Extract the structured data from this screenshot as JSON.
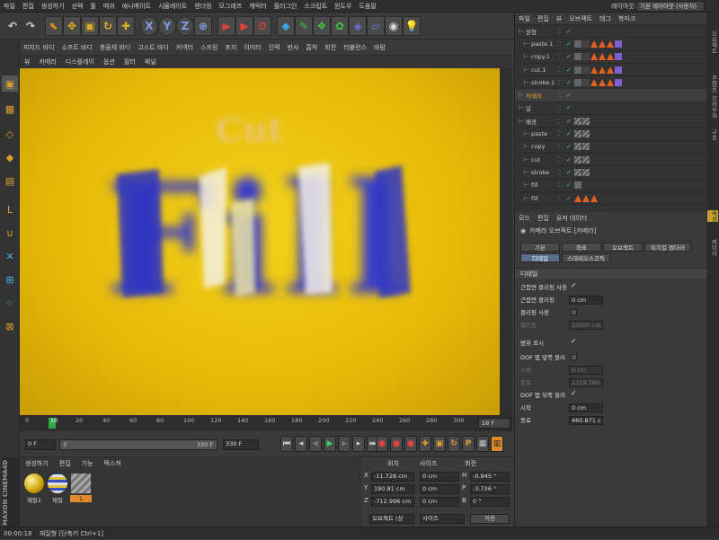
{
  "menu": [
    "파일",
    "편집",
    "생성하기",
    "선택",
    "툴",
    "메쉬",
    "애니메이트",
    "시뮬레이트",
    "렌더링",
    "모그래프",
    "캐릭터",
    "플러그인",
    "스크립트",
    "윈도우",
    "도움말"
  ],
  "layout": {
    "label": "레이아웃:",
    "value": "기본 레이아웃 (사용자)"
  },
  "view_bar": [
    "피지드 바디",
    "소프트 바디",
    "충돌체 바디",
    "고스트 바디",
    "커넥터",
    "스프링",
    "포지",
    "이미터",
    "인력",
    "반사",
    "흡착",
    "회전",
    "터뷸런스",
    "바람"
  ],
  "view_menu": [
    "뷰",
    "카메라",
    "디스플레이",
    "옵션",
    "필터",
    "패널"
  ],
  "viewport": {
    "text_small": "Cut",
    "text_big": "Fill"
  },
  "timeline": {
    "ticks": [
      "0",
      "10",
      "20",
      "40",
      "60",
      "80",
      "100",
      "120",
      "140",
      "160",
      "180",
      "200",
      "220",
      "240",
      "260",
      "280",
      "300",
      "320"
    ],
    "current": "18",
    "end_frame": "18 F"
  },
  "transport": {
    "start_field": "0 F",
    "range_start": "F",
    "range_end": "330 F",
    "end_field": "330 F"
  },
  "material_panel": {
    "menu": [
      "생성하기",
      "편집",
      "기능",
      "텍스쳐"
    ],
    "materials": [
      {
        "label": "재질1",
        "color": "#d8b400"
      },
      {
        "label": "재질",
        "color": "#4060c0"
      },
      {
        "label": "1",
        "color": "#888888"
      }
    ]
  },
  "coords": {
    "headers": [
      "위치",
      "사이즈",
      "회전"
    ],
    "rows": [
      {
        "axis": "X",
        "pos": "-11.728 cm",
        "size": "0 cm",
        "rot_label": "H",
        "rot": "-0.945 °"
      },
      {
        "axis": "Y",
        "pos": "190.81 cm",
        "size": "0 cm",
        "rot_label": "P",
        "rot": "-3.736 °"
      },
      {
        "axis": "Z",
        "pos": "-712.996 cm",
        "size": "0 cm",
        "rot_label": "B",
        "rot": "0 °"
      }
    ],
    "mode": "오브젝트 (상",
    "size_mode": "사이즈",
    "apply": "적용"
  },
  "object_manager": {
    "menu": [
      "파일",
      "편집",
      "뷰",
      "오브젝트",
      "태그",
      "북마크"
    ],
    "objects": [
      {
        "name": "원형",
        "indent": 0,
        "color": "#ccc"
      },
      {
        "name": "paste.1",
        "indent": 1,
        "color": "#ccc"
      },
      {
        "name": "copy.1",
        "indent": 1,
        "color": "#ccc"
      },
      {
        "name": "cut.1",
        "indent": 1,
        "color": "#ccc"
      },
      {
        "name": "stroke.1",
        "indent": 1,
        "color": "#ccc"
      },
      {
        "name": "카메라",
        "indent": 0,
        "color": "#f0a030"
      },
      {
        "name": "널",
        "indent": 0,
        "color": "#ccc"
      },
      {
        "name": "배경",
        "indent": 0,
        "color": "#ccc"
      },
      {
        "name": "paste",
        "indent": 1,
        "color": "#ccc"
      },
      {
        "name": "copy",
        "indent": 1,
        "color": "#ccc"
      },
      {
        "name": "cut",
        "indent": 1,
        "color": "#ccc"
      },
      {
        "name": "stroke",
        "indent": 1,
        "color": "#ccc"
      },
      {
        "name": "fill",
        "indent": 1,
        "color": "#ccc"
      },
      {
        "name": "fill",
        "indent": 1,
        "color": "#ccc"
      }
    ]
  },
  "attributes": {
    "menu": [
      "모드",
      "편집",
      "유저 데이터"
    ],
    "object_title": "카메라 오브젝트 [카메라]",
    "tabs_row1": [
      "기본",
      "좌표",
      "오브젝트",
      "피지컬 렌더러"
    ],
    "tabs_row2": [
      "디테일",
      "스테레오스코픽"
    ],
    "section": "디테일",
    "rows": [
      {
        "label": "근접면 클리핑 사용",
        "value": "✓",
        "kind": "check"
      },
      {
        "label": "근접면 클리핑",
        "value": "0 cm",
        "kind": "field"
      },
      {
        "label": "클리핑 사용",
        "value": "",
        "kind": "check-empty"
      },
      {
        "label": "클리핑",
        "value": "10000 cm",
        "kind": "field-dim"
      },
      {
        "label": "범위 표시",
        "value": "✓",
        "kind": "check"
      },
      {
        "label": "DOF 맵 앞쪽 블러",
        "value": "",
        "kind": "check-empty"
      },
      {
        "label": "시작",
        "value": "0 cm",
        "kind": "field-dim"
      },
      {
        "label": "종료",
        "value": "1319.786",
        "kind": "field-dim"
      },
      {
        "label": "DOF 맵 뒤쪽 블러",
        "value": "✓",
        "kind": "check"
      },
      {
        "label": "시작",
        "value": "0 cm",
        "kind": "field"
      },
      {
        "label": "종료",
        "value": "460.871 c",
        "kind": "field"
      }
    ]
  },
  "right_tabs": [
    "오브젝트",
    "콘텐츠 브라우저",
    "구조",
    "속성",
    "레이어"
  ],
  "status": "00:00:18",
  "status_text": "재질형 [단축키 Ctrl+1]"
}
